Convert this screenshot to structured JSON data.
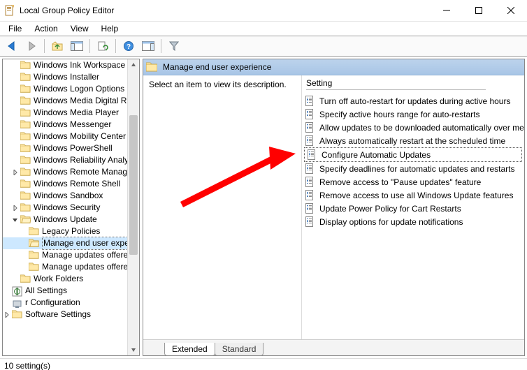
{
  "window": {
    "title": "Local Group Policy Editor"
  },
  "menu": {
    "items": [
      "File",
      "Action",
      "View",
      "Help"
    ]
  },
  "toolbar": {
    "buttons": [
      {
        "name": "back-icon"
      },
      {
        "name": "forward-icon"
      },
      {
        "sep": true
      },
      {
        "name": "up-folder-icon"
      },
      {
        "name": "show-hide-tree-icon"
      },
      {
        "sep": true
      },
      {
        "name": "refresh-icon"
      },
      {
        "sep": true
      },
      {
        "name": "help-icon"
      },
      {
        "name": "show-hide-action-icon"
      },
      {
        "sep": true
      },
      {
        "name": "filter-icon"
      }
    ]
  },
  "tree": {
    "visible_items": [
      {
        "depth": 1,
        "label": "Windows Ink Workspace"
      },
      {
        "depth": 1,
        "label": "Windows Installer"
      },
      {
        "depth": 1,
        "label": "Windows Logon Options"
      },
      {
        "depth": 1,
        "label": "Windows Media Digital Rig"
      },
      {
        "depth": 1,
        "label": "Windows Media Player"
      },
      {
        "depth": 1,
        "label": "Windows Messenger"
      },
      {
        "depth": 1,
        "label": "Windows Mobility Center"
      },
      {
        "depth": 1,
        "label": "Windows PowerShell"
      },
      {
        "depth": 1,
        "label": "Windows Reliability Analys"
      },
      {
        "depth": 1,
        "label": "Windows Remote Manage",
        "expander": "collapsed"
      },
      {
        "depth": 1,
        "label": "Windows Remote Shell"
      },
      {
        "depth": 1,
        "label": "Windows Sandbox"
      },
      {
        "depth": 1,
        "label": "Windows Security",
        "expander": "collapsed"
      },
      {
        "depth": 1,
        "label": "Windows Update",
        "expander": "expanded",
        "container": true,
        "children": [
          {
            "depth": 2,
            "label": "Legacy Policies"
          },
          {
            "depth": 2,
            "label": "Manage end user expe",
            "selected": true
          },
          {
            "depth": 2,
            "label": "Manage updates offere"
          },
          {
            "depth": 2,
            "label": "Manage updates offere"
          }
        ]
      },
      {
        "depth": 1,
        "label": "Work Folders"
      },
      {
        "depth": 0,
        "label": "All Settings",
        "icon": "all-settings"
      },
      {
        "depth": -1,
        "label": "r Configuration",
        "icon": "config"
      },
      {
        "depth": 0,
        "label": "Software Settings",
        "icon": "folder",
        "expander": "collapsed"
      }
    ]
  },
  "right": {
    "header_label": "Manage end user experience",
    "description_prompt": "Select an item to view its description.",
    "column_header": "Setting",
    "settings": [
      "Turn off auto-restart for updates during active hours",
      "Specify active hours range for auto-restarts",
      "Allow updates to be downloaded automatically over metere",
      "Always automatically restart at the scheduled time",
      "Configure Automatic Updates",
      "Specify deadlines for automatic updates and restarts",
      "Remove access to \"Pause updates\" feature",
      "Remove access to use all Windows Update features",
      "Update Power Policy for Cart Restarts",
      "Display options for update notifications"
    ],
    "highlighted_index": 4,
    "tabs": [
      "Extended",
      "Standard"
    ],
    "active_tab": 0
  },
  "statusbar": {
    "text": "10 setting(s)"
  }
}
